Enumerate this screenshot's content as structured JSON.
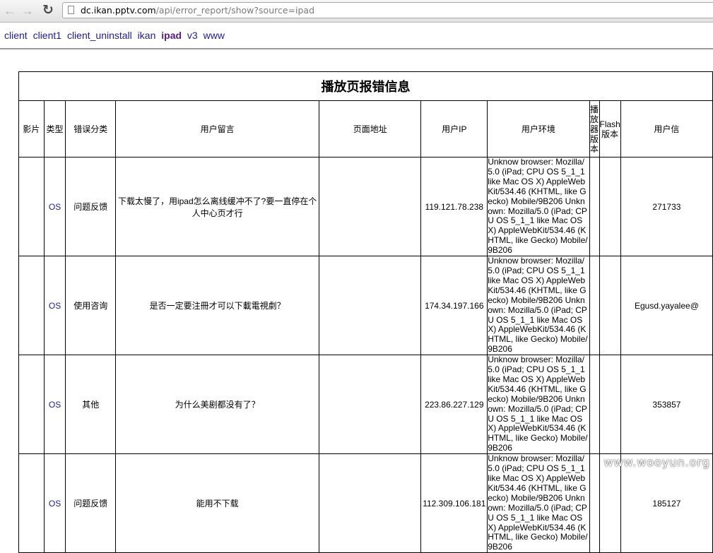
{
  "browser": {
    "url_host": "dc.ikan.pptv.com",
    "url_path": "/api/error_report/show?source=ipad"
  },
  "nav_links": [
    "client",
    "client1",
    "client_uninstall",
    "ikan",
    "ipad",
    "v3",
    "www"
  ],
  "table": {
    "title": "播放页报错信息",
    "headers": [
      "影片",
      "类型",
      "错误分类",
      "用户留言",
      "页面地址",
      "用户IP",
      "用户环境",
      "播放器版本",
      "Flash版本",
      "用户信"
    ],
    "rows": [
      {
        "type": "OS",
        "category": "问题反馈",
        "message": "下载太慢了，用ipad怎么离线缓冲不了?要一直停在个人中心页才行",
        "ip": "119.121.78.238",
        "env": "Unknow browser: Mozilla/5.0 (iPad; CPU OS 5_1_1 like Mac OS X) AppleWebKit/534.46 (KHTML, like Gecko) Mobile/9B206 Unknown: Mozilla/5.0 (iPad; CPU OS 5_1_1 like Mac OS X) AppleWebKit/534.46 (KHTML, like Gecko) Mobile/9B206",
        "user": "271733"
      },
      {
        "type": "OS",
        "category": "使用咨询",
        "message": "是否一定要注冊才可以下載電視劇？",
        "ip": "174.34.197.166",
        "env": "Unknow browser: Mozilla/5.0 (iPad; CPU OS 5_1_1 like Mac OS X) AppleWebKit/534.46 (KHTML, like Gecko) Mobile/9B206 Unknown: Mozilla/5.0 (iPad; CPU OS 5_1_1 like Mac OS X) AppleWebKit/534.46 (KHTML, like Gecko) Mobile/9B206",
        "user": "Egusd.yayalee@"
      },
      {
        "type": "OS",
        "category": "其他",
        "message": "为什么美剧都没有了？",
        "ip": "223.86.227.129",
        "env": "Unknow browser: Mozilla/5.0 (iPad; CPU OS 5_1_1 like Mac OS X) AppleWebKit/534.46 (KHTML, like Gecko) Mobile/9B206 Unknown: Mozilla/5.0 (iPad; CPU OS 5_1_1 like Mac OS X) AppleWebKit/534.46 (KHTML, like Gecko) Mobile/9B206",
        "user": "353857"
      },
      {
        "type": "OS",
        "category": "问题反馈",
        "message": "能用不下载",
        "ip": "112.309.106.181",
        "env": "Unknow browser: Mozilla/5.0 (iPad; CPU OS 5_1_1 like Mac OS X) AppleWebKit/534.46 (KHTML, like Gecko) Mobile/9B206 Unknown: Mozilla/5.0 (iPad; CPU OS 5_1_1 like Mac OS X) AppleWebKit/534.46 (KHTML, like Gecko) Mobile/9B206",
        "user": "185127"
      }
    ]
  },
  "watermark": "www.wooyun.org"
}
